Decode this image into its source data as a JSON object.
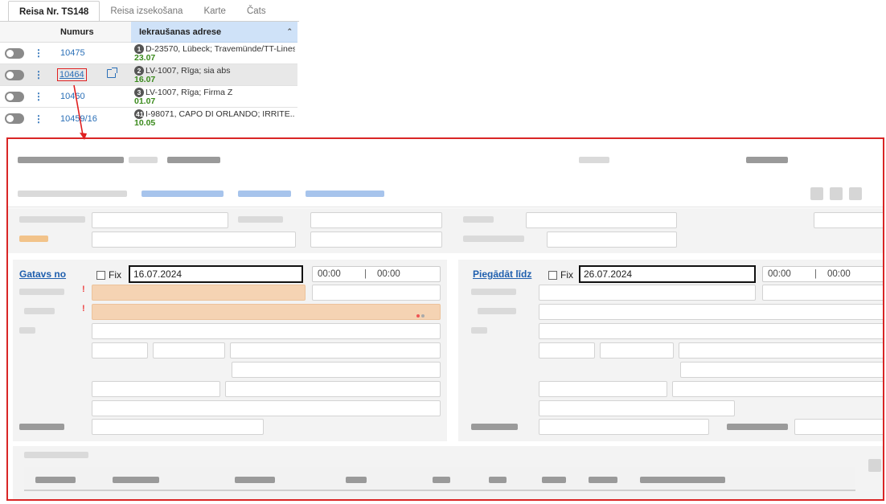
{
  "tabs": [
    {
      "label": "Reisa Nr. TS148",
      "active": true
    },
    {
      "label": "Reisa izsekošana",
      "active": false
    },
    {
      "label": "Karte",
      "active": false
    },
    {
      "label": "Čats",
      "active": false
    }
  ],
  "grid": {
    "col_number": "Numurs",
    "col_address": "Iekraušanas adrese",
    "sort_icon": "sort-icon",
    "rows": [
      {
        "number": "10475",
        "badge": "1",
        "address": "D-23570, Lübeck; Travemünde/TT-Lines",
        "date": "23.07",
        "selected": false
      },
      {
        "number": "10464",
        "badge": "2",
        "address": "LV-1007, Rīga; sia abs",
        "date": "16.07",
        "selected": true
      },
      {
        "number": "10460",
        "badge": "3",
        "address": "LV-1007, Rīga; Firma Z",
        "date": "01.07",
        "selected": false
      },
      {
        "number": "10459/16",
        "badge": "41",
        "address": "I-98071, CAPO DI ORLANDO; IRRITE...",
        "date": "10.05",
        "selected": false
      }
    ]
  },
  "form": {
    "pickup": {
      "title": "Gatavs no",
      "fix_label": "Fix",
      "date": "16.07.2024",
      "time_from": "00:00",
      "time_sep": "|",
      "time_to": "00:00"
    },
    "delivery": {
      "title": "Piegādāt līdz",
      "fix_label": "Fix",
      "date": "26.07.2024",
      "time_from": "00:00",
      "time_sep": "|",
      "time_to": "00:00"
    }
  },
  "colors": {
    "highlight_border": "#d92626",
    "link": "#1f5fae",
    "date_green": "#3a8a1c",
    "selected_header": "#cfe2f8"
  }
}
